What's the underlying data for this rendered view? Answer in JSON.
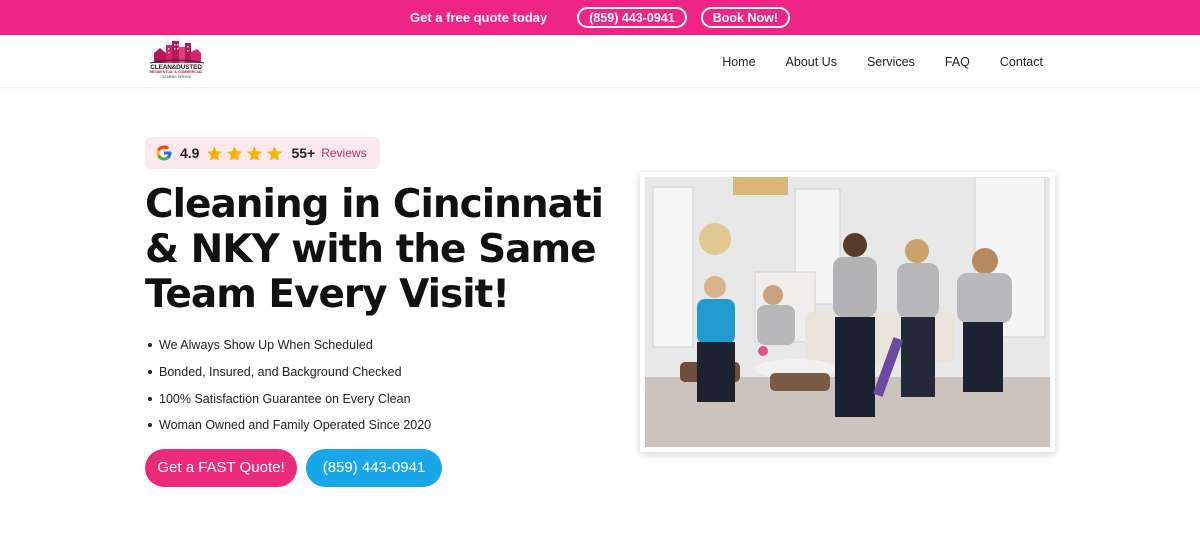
{
  "topbar": {
    "promo_text": "Get a free quote today",
    "phone": "(859) 443-0941",
    "book_label": "Book Now!",
    "bg_color": "#ef2586"
  },
  "header": {
    "logo": {
      "line1": "CLEAN&DUSTED",
      "line2": "RESIDENTIAL & COMMERCIAL",
      "line3": "CLEANING SERVICE"
    },
    "nav": [
      {
        "label": "Home"
      },
      {
        "label": "About Us"
      },
      {
        "label": "Services"
      },
      {
        "label": "FAQ"
      },
      {
        "label": "Contact"
      }
    ]
  },
  "hero": {
    "reviews": {
      "icon": "google-g-icon",
      "rating": "4.9",
      "stars": 4,
      "count": "55+",
      "label": "Reviews"
    },
    "headline": "Cleaning in Cincinnati & NKY with the Same Team Every Visit!",
    "bullets": [
      "We Always Show Up When Scheduled",
      "Bonded, Insured, and Background Checked",
      "100% Satisfaction Guarantee on Every Clean",
      "Woman Owned and Family Operated Since 2020"
    ],
    "cta_quote": "Get a FAST Quote!",
    "cta_phone": "(859) 443-0941",
    "colors": {
      "pink": "#ec2a7a",
      "blue": "#1aa7ea",
      "badge_bg": "#fde8ee"
    }
  }
}
